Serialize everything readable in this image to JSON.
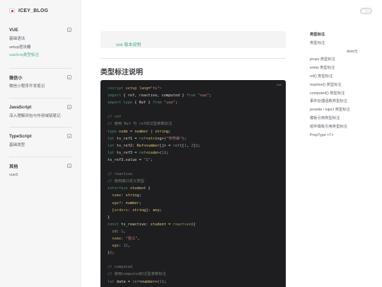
{
  "brand": {
    "title": "ICEY_BLOG",
    "logo": "korea-flag-icon"
  },
  "sidebar": {
    "groups": [
      {
        "title": "VUE",
        "items": [
          "基础语法",
          "setup语法糖",
          "vue3+ts类型标注"
        ],
        "active_index": 2
      },
      {
        "title": "微信小",
        "items": [
          "微信小程序开发笔记"
        ]
      },
      {
        "title": "JavaScript",
        "items": [
          "深入理解闭包与作用域链笔记"
        ]
      },
      {
        "title": "TypeScript",
        "items": [
          "基础类型"
        ]
      },
      {
        "title": "其他",
        "items": [
          "vue3"
        ]
      }
    ]
  },
  "toggle": {
    "state": "off",
    "icon": "theme-toggle-icon"
  },
  "main": {
    "info": "vue 版本说明",
    "heading": "类型标注说明",
    "code_lang": "vue",
    "code_lines": [
      [
        [
          "t-tag",
          "<script"
        ],
        [
          "t-default",
          " "
        ],
        [
          "t-attr",
          "setup"
        ],
        [
          "t-default",
          " "
        ],
        [
          "t-attr",
          "lang"
        ],
        [
          "t-default",
          "="
        ],
        [
          "t-string",
          "\"ts\""
        ],
        [
          "t-tag",
          ">"
        ]
      ],
      [
        [
          "t-keyword",
          "import"
        ],
        [
          "t-default",
          " { ref, reactive, computed } "
        ],
        [
          "t-keyword",
          "from"
        ],
        [
          "t-default",
          " "
        ],
        [
          "t-string",
          "\"vue\""
        ],
        [
          "t-default",
          ";"
        ]
      ],
      [
        [
          "t-keyword",
          "import"
        ],
        [
          "t-default",
          " "
        ],
        [
          "t-keyword",
          "type"
        ],
        [
          "t-default",
          " { Ref } "
        ],
        [
          "t-keyword",
          "from"
        ],
        [
          "t-default",
          " "
        ],
        [
          "t-string",
          "\"vue\""
        ],
        [
          "t-default",
          ";"
        ]
      ],
      [],
      [
        [
          "t-comment",
          "// ref"
        ]
      ],
      [
        [
          "t-comment",
          "// 使用 Ref 与 ref的泛型参数标注"
        ]
      ],
      [
        [
          "t-keyword",
          "type"
        ],
        [
          "t-default",
          " "
        ],
        [
          "t-type",
          "code"
        ],
        [
          "t-default",
          " = "
        ],
        [
          "t-type",
          "number"
        ],
        [
          "t-default",
          " | "
        ],
        [
          "t-type",
          "string"
        ],
        [
          "t-default",
          ";"
        ]
      ],
      [
        [
          "t-keyword",
          "let"
        ],
        [
          "t-default",
          " ts_ref1 = "
        ],
        [
          "t-func",
          "ref"
        ],
        [
          "t-default",
          "<"
        ],
        [
          "t-type",
          "string"
        ],
        [
          "t-default",
          ">("
        ],
        [
          "t-string",
          "\"字符串\""
        ],
        [
          "t-default",
          ");"
        ]
      ],
      [
        [
          "t-keyword",
          "let"
        ],
        [
          "t-default",
          " ts_ref2: "
        ],
        [
          "t-type",
          "Ref"
        ],
        [
          "t-default",
          "<"
        ],
        [
          "t-type",
          "number"
        ],
        [
          "t-default",
          "[]> = "
        ],
        [
          "t-func",
          "ref"
        ],
        [
          "t-default",
          "(["
        ],
        [
          "t-number",
          "1"
        ],
        [
          "t-default",
          ", "
        ],
        [
          "t-number",
          "2"
        ],
        [
          "t-default",
          "]);"
        ]
      ],
      [
        [
          "t-keyword",
          "let"
        ],
        [
          "t-default",
          " ts_ref3 = "
        ],
        [
          "t-func",
          "ref"
        ],
        [
          "t-default",
          "<"
        ],
        [
          "t-type",
          "code"
        ],
        [
          "t-default",
          ">("
        ],
        [
          "t-number",
          "1"
        ],
        [
          "t-default",
          ");"
        ]
      ],
      [
        [
          "t-default",
          "ts_ref3.value = "
        ],
        [
          "t-string",
          "\"1\""
        ],
        [
          "t-default",
          ";"
        ]
      ],
      [],
      [
        [
          "t-comment",
          "// reactive"
        ]
      ],
      [
        [
          "t-comment",
          "// 使用接口定义类型"
        ]
      ],
      [
        [
          "t-keyword",
          "interface"
        ],
        [
          "t-default",
          " "
        ],
        [
          "t-type",
          "student"
        ],
        [
          "t-default",
          " {"
        ]
      ],
      [
        [
          "t-default",
          "  "
        ],
        [
          "t-prop",
          "name"
        ],
        [
          "t-default",
          ": "
        ],
        [
          "t-type",
          "string"
        ],
        [
          "t-default",
          ";"
        ]
      ],
      [
        [
          "t-default",
          "  "
        ],
        [
          "t-prop",
          "age?"
        ],
        [
          "t-default",
          ": "
        ],
        [
          "t-type",
          "number"
        ],
        [
          "t-default",
          ";"
        ]
      ],
      [
        [
          "t-default",
          "  ["
        ],
        [
          "t-prop",
          "orders"
        ],
        [
          "t-default",
          ": "
        ],
        [
          "t-type",
          "string"
        ],
        [
          "t-default",
          "]: "
        ],
        [
          "t-type",
          "any"
        ],
        [
          "t-default",
          ";"
        ]
      ],
      [
        [
          "t-default",
          "}"
        ]
      ],
      [
        [
          "t-keyword",
          "const"
        ],
        [
          "t-default",
          " ts_reactive: "
        ],
        [
          "t-type",
          "student"
        ],
        [
          "t-default",
          " = "
        ],
        [
          "t-func",
          "reactive"
        ],
        [
          "t-default",
          "({"
        ]
      ],
      [
        [
          "t-default",
          "  "
        ],
        [
          "t-prop",
          "id"
        ],
        [
          "t-default",
          ": "
        ],
        [
          "t-number",
          "1"
        ],
        [
          "t-default",
          ","
        ]
      ],
      [
        [
          "t-default",
          "  "
        ],
        [
          "t-prop",
          "name"
        ],
        [
          "t-default",
          ": "
        ],
        [
          "t-string",
          "\"张三\""
        ],
        [
          "t-default",
          ","
        ]
      ],
      [
        [
          "t-default",
          "  "
        ],
        [
          "t-prop",
          "age"
        ],
        [
          "t-default",
          ": "
        ],
        [
          "t-number",
          "12"
        ],
        [
          "t-default",
          ","
        ]
      ],
      [
        [
          "t-default",
          "});"
        ]
      ],
      [],
      [
        [
          "t-comment",
          "// computed"
        ]
      ],
      [
        [
          "t-comment",
          "// 使用computed的泛型参数标注"
        ]
      ],
      [
        [
          "t-keyword",
          "let"
        ],
        [
          "t-default",
          " data = "
        ],
        [
          "t-func",
          "ref"
        ],
        [
          "t-default",
          "<"
        ],
        [
          "t-type",
          "number"
        ],
        [
          "t-default",
          ">("
        ],
        [
          "t-number",
          "1"
        ],
        [
          "t-default",
          ");"
        ]
      ]
    ]
  },
  "outline": {
    "items": [
      {
        "label": "类型标注",
        "active": true
      },
      {
        "label": "类型标注"
      },
      {
        "label": "dom元",
        "sub": true
      },
      {
        "label": "props 类型标注"
      },
      {
        "label": "emits 类型标注"
      },
      {
        "label": "ref() 类型标注"
      },
      {
        "label": "reactive() 类型标注"
      },
      {
        "label": "computed() 类型标注"
      },
      {
        "label": "事件处理函数类型标注"
      },
      {
        "label": "provide / inject 类型标注"
      },
      {
        "label": "模板引用类型标注"
      },
      {
        "label": "组件模板引用类型标注"
      },
      {
        "label": "PropType <T>"
      }
    ]
  },
  "colors": {
    "accent": "#3eaf7c",
    "code_bg": "#1e1e20",
    "sidebar_bg": "#f6f6f7"
  }
}
